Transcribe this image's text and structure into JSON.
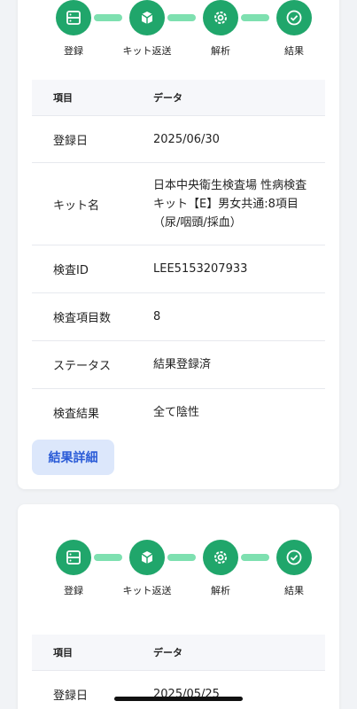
{
  "colors": {
    "step_active": "#20a66b",
    "connector": "#7ee0b0",
    "button_bg": "#dce7fb",
    "button_text": "#2a5bd7",
    "page_bg": "#f1f3f6"
  },
  "steps": [
    {
      "label": "登録",
      "icon": "server-icon"
    },
    {
      "label": "キット返送",
      "icon": "box-icon"
    },
    {
      "label": "解析",
      "icon": "gear-icon"
    },
    {
      "label": "結果",
      "icon": "check-circle-icon"
    }
  ],
  "table_header": {
    "item": "項目",
    "data": "データ"
  },
  "card1": {
    "rows": [
      {
        "key": "登録日",
        "value": "2025/06/30"
      },
      {
        "key": "キット名",
        "value": "日本中央衛生検査場 性病検査キット【E】男女共通:8項目（尿/咽頭/採血）"
      },
      {
        "key": "検査ID",
        "value": "LEE5153207933"
      },
      {
        "key": "検査項目数",
        "value": "8"
      },
      {
        "key": "ステータス",
        "value": "結果登録済"
      },
      {
        "key": "検査結果",
        "value": "全て陰性"
      }
    ],
    "button_label": "結果詳細"
  },
  "card2": {
    "rows": [
      {
        "key": "登録日",
        "value": "2025/05/25"
      }
    ]
  }
}
